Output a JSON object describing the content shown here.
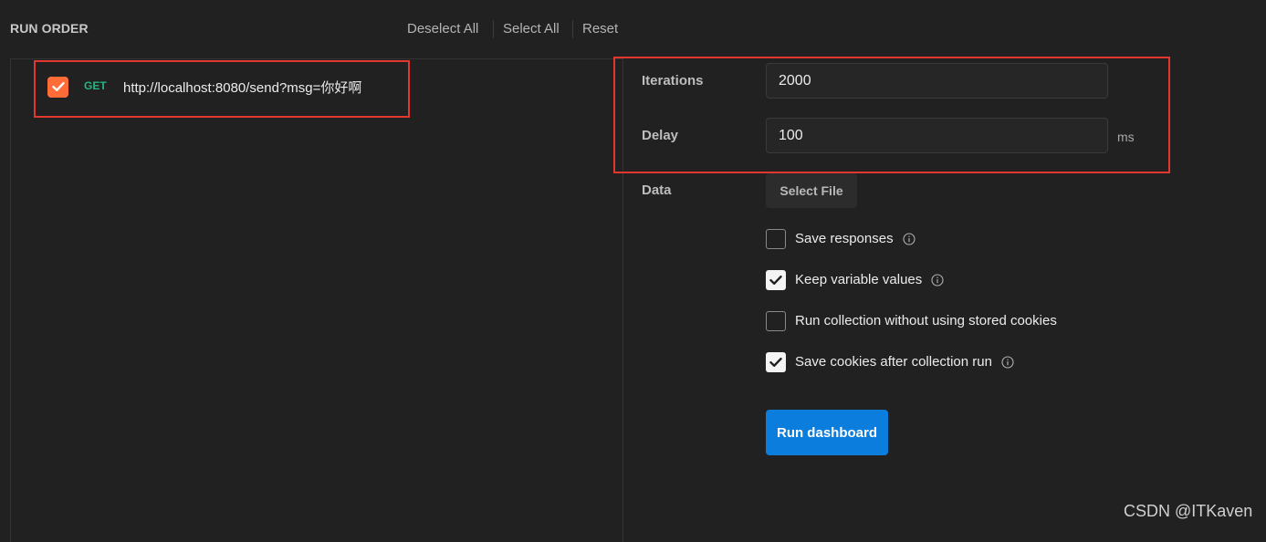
{
  "header": {
    "title": "RUN ORDER",
    "actions": [
      "Deselect All",
      "Select All",
      "Reset"
    ]
  },
  "requests": [
    {
      "checked": true,
      "method": "GET",
      "url": "http://localhost:8080/send?msg=你好啊"
    }
  ],
  "settings": {
    "iterations_label": "Iterations",
    "iterations_value": "2000",
    "delay_label": "Delay",
    "delay_value": "100",
    "delay_unit": "ms",
    "data_label": "Data",
    "select_file_label": "Select File"
  },
  "options": [
    {
      "label": "Save responses",
      "checked": false,
      "info_icon": true
    },
    {
      "label": "Keep variable values",
      "checked": true,
      "info_icon": true
    },
    {
      "label": "Run collection without using stored cookies",
      "checked": false,
      "info_icon": false
    },
    {
      "label": "Save cookies after collection run",
      "checked": true,
      "info_icon": true
    }
  ],
  "run_button_label": "Run dashboard",
  "watermark": "CSDN @ITKaven",
  "colors": {
    "accent_orange": "#ff6c37",
    "method_get": "#26b47f",
    "primary_blue": "#0b7ddd",
    "highlight_red": "#e1372f"
  }
}
